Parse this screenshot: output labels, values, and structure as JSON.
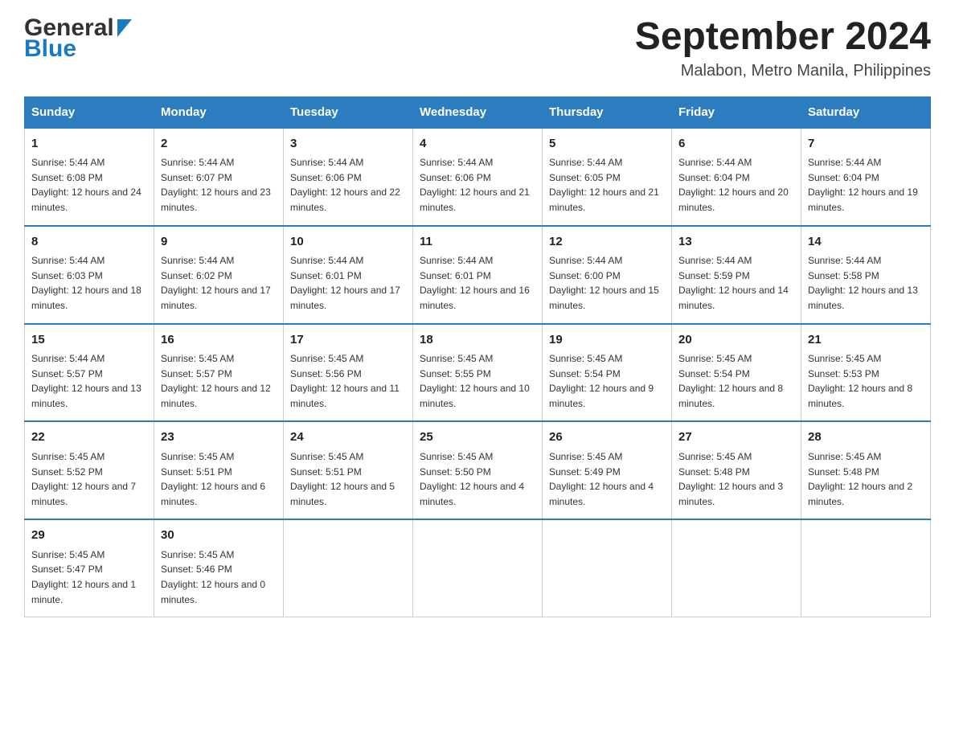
{
  "header": {
    "logo_general": "General",
    "logo_blue": "Blue",
    "month_title": "September 2024",
    "location": "Malabon, Metro Manila, Philippines"
  },
  "days_of_week": [
    "Sunday",
    "Monday",
    "Tuesday",
    "Wednesday",
    "Thursday",
    "Friday",
    "Saturday"
  ],
  "weeks": [
    [
      {
        "day": "1",
        "sunrise": "5:44 AM",
        "sunset": "6:08 PM",
        "daylight": "12 hours and 24 minutes."
      },
      {
        "day": "2",
        "sunrise": "5:44 AM",
        "sunset": "6:07 PM",
        "daylight": "12 hours and 23 minutes."
      },
      {
        "day": "3",
        "sunrise": "5:44 AM",
        "sunset": "6:06 PM",
        "daylight": "12 hours and 22 minutes."
      },
      {
        "day": "4",
        "sunrise": "5:44 AM",
        "sunset": "6:06 PM",
        "daylight": "12 hours and 21 minutes."
      },
      {
        "day": "5",
        "sunrise": "5:44 AM",
        "sunset": "6:05 PM",
        "daylight": "12 hours and 21 minutes."
      },
      {
        "day": "6",
        "sunrise": "5:44 AM",
        "sunset": "6:04 PM",
        "daylight": "12 hours and 20 minutes."
      },
      {
        "day": "7",
        "sunrise": "5:44 AM",
        "sunset": "6:04 PM",
        "daylight": "12 hours and 19 minutes."
      }
    ],
    [
      {
        "day": "8",
        "sunrise": "5:44 AM",
        "sunset": "6:03 PM",
        "daylight": "12 hours and 18 minutes."
      },
      {
        "day": "9",
        "sunrise": "5:44 AM",
        "sunset": "6:02 PM",
        "daylight": "12 hours and 17 minutes."
      },
      {
        "day": "10",
        "sunrise": "5:44 AM",
        "sunset": "6:01 PM",
        "daylight": "12 hours and 17 minutes."
      },
      {
        "day": "11",
        "sunrise": "5:44 AM",
        "sunset": "6:01 PM",
        "daylight": "12 hours and 16 minutes."
      },
      {
        "day": "12",
        "sunrise": "5:44 AM",
        "sunset": "6:00 PM",
        "daylight": "12 hours and 15 minutes."
      },
      {
        "day": "13",
        "sunrise": "5:44 AM",
        "sunset": "5:59 PM",
        "daylight": "12 hours and 14 minutes."
      },
      {
        "day": "14",
        "sunrise": "5:44 AM",
        "sunset": "5:58 PM",
        "daylight": "12 hours and 13 minutes."
      }
    ],
    [
      {
        "day": "15",
        "sunrise": "5:44 AM",
        "sunset": "5:57 PM",
        "daylight": "12 hours and 13 minutes."
      },
      {
        "day": "16",
        "sunrise": "5:45 AM",
        "sunset": "5:57 PM",
        "daylight": "12 hours and 12 minutes."
      },
      {
        "day": "17",
        "sunrise": "5:45 AM",
        "sunset": "5:56 PM",
        "daylight": "12 hours and 11 minutes."
      },
      {
        "day": "18",
        "sunrise": "5:45 AM",
        "sunset": "5:55 PM",
        "daylight": "12 hours and 10 minutes."
      },
      {
        "day": "19",
        "sunrise": "5:45 AM",
        "sunset": "5:54 PM",
        "daylight": "12 hours and 9 minutes."
      },
      {
        "day": "20",
        "sunrise": "5:45 AM",
        "sunset": "5:54 PM",
        "daylight": "12 hours and 8 minutes."
      },
      {
        "day": "21",
        "sunrise": "5:45 AM",
        "sunset": "5:53 PM",
        "daylight": "12 hours and 8 minutes."
      }
    ],
    [
      {
        "day": "22",
        "sunrise": "5:45 AM",
        "sunset": "5:52 PM",
        "daylight": "12 hours and 7 minutes."
      },
      {
        "day": "23",
        "sunrise": "5:45 AM",
        "sunset": "5:51 PM",
        "daylight": "12 hours and 6 minutes."
      },
      {
        "day": "24",
        "sunrise": "5:45 AM",
        "sunset": "5:51 PM",
        "daylight": "12 hours and 5 minutes."
      },
      {
        "day": "25",
        "sunrise": "5:45 AM",
        "sunset": "5:50 PM",
        "daylight": "12 hours and 4 minutes."
      },
      {
        "day": "26",
        "sunrise": "5:45 AM",
        "sunset": "5:49 PM",
        "daylight": "12 hours and 4 minutes."
      },
      {
        "day": "27",
        "sunrise": "5:45 AM",
        "sunset": "5:48 PM",
        "daylight": "12 hours and 3 minutes."
      },
      {
        "day": "28",
        "sunrise": "5:45 AM",
        "sunset": "5:48 PM",
        "daylight": "12 hours and 2 minutes."
      }
    ],
    [
      {
        "day": "29",
        "sunrise": "5:45 AM",
        "sunset": "5:47 PM",
        "daylight": "12 hours and 1 minute."
      },
      {
        "day": "30",
        "sunrise": "5:45 AM",
        "sunset": "5:46 PM",
        "daylight": "12 hours and 0 minutes."
      },
      null,
      null,
      null,
      null,
      null
    ]
  ]
}
